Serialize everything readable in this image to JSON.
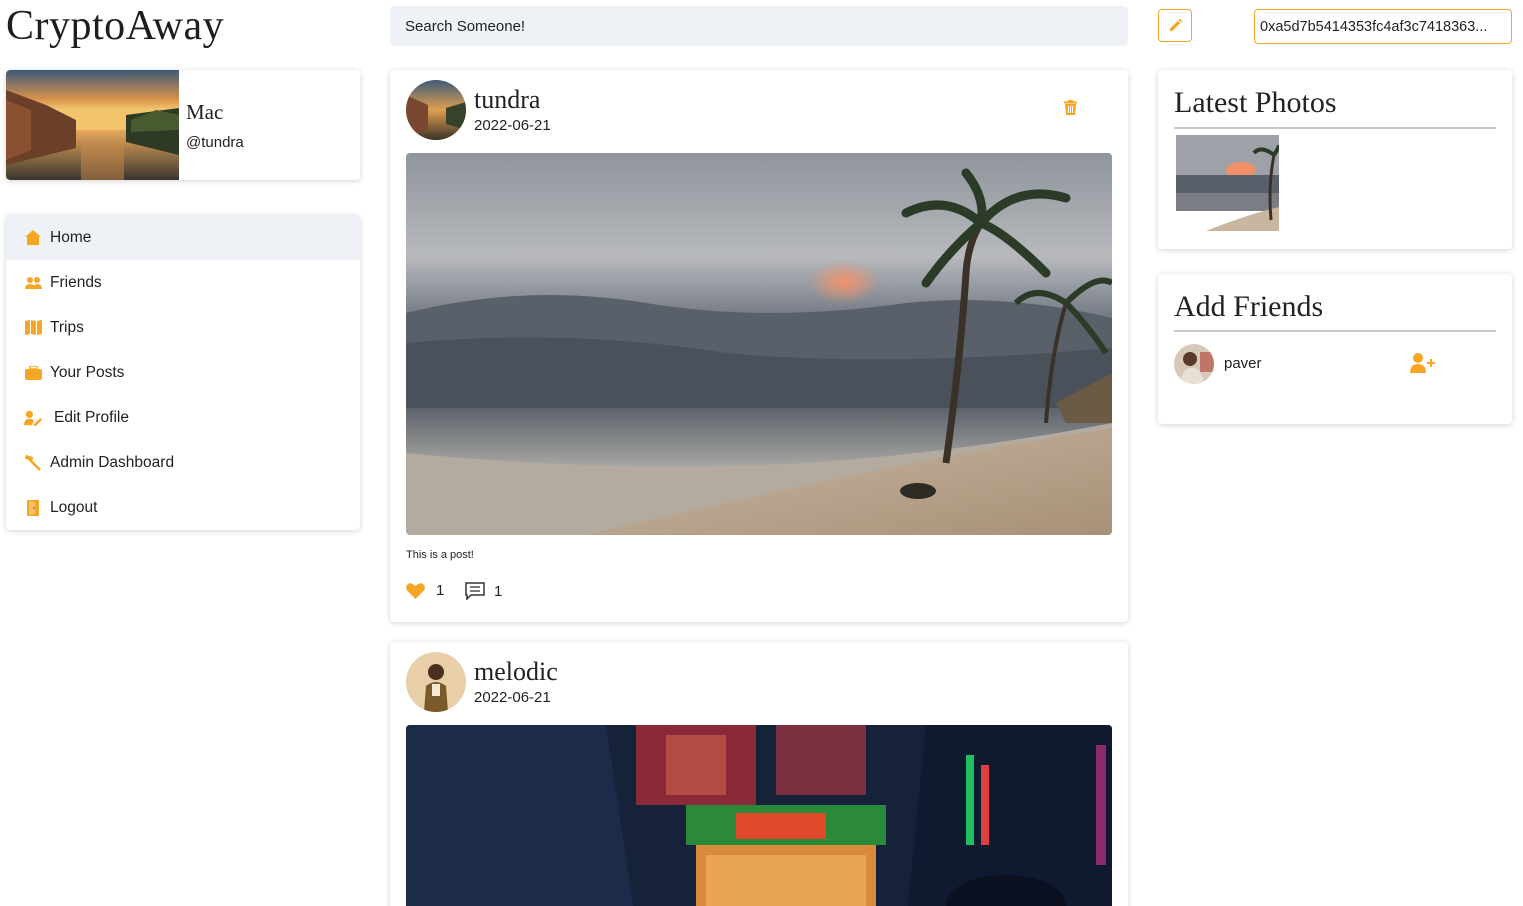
{
  "app": {
    "title": "CryptoAway"
  },
  "search": {
    "placeholder": "Search Someone!"
  },
  "wallet": {
    "address": "0xa5d7b5414353fc4af3c7418363..."
  },
  "profile": {
    "name": "Mac",
    "handle": "@tundra"
  },
  "nav": {
    "items": [
      {
        "label": "Home",
        "icon": "home-icon",
        "active": true
      },
      {
        "label": "Friends",
        "icon": "users-icon",
        "active": false
      },
      {
        "label": "Trips",
        "icon": "map-icon",
        "active": false
      },
      {
        "label": "Your Posts",
        "icon": "briefcase-icon",
        "active": false
      },
      {
        "label": "Edit Profile",
        "icon": "user-edit-icon",
        "active": false
      },
      {
        "label": "Admin Dashboard",
        "icon": "hammer-icon",
        "active": false
      },
      {
        "label": "Logout",
        "icon": "door-icon",
        "active": false
      }
    ]
  },
  "posts": [
    {
      "user": "tundra",
      "date": "2022-06-21",
      "text": "This is a post!",
      "likes": "1",
      "comments": "1"
    },
    {
      "user": "melodic",
      "date": "2022-06-21"
    }
  ],
  "sidebar": {
    "latest_photos_title": "Latest Photos",
    "add_friends_title": "Add Friends",
    "suggestions": [
      {
        "name": "paver"
      }
    ]
  },
  "colors": {
    "accent": "#f5a623",
    "search_bg": "#eef1f5",
    "active_nav_bg": "#eef1f5"
  }
}
